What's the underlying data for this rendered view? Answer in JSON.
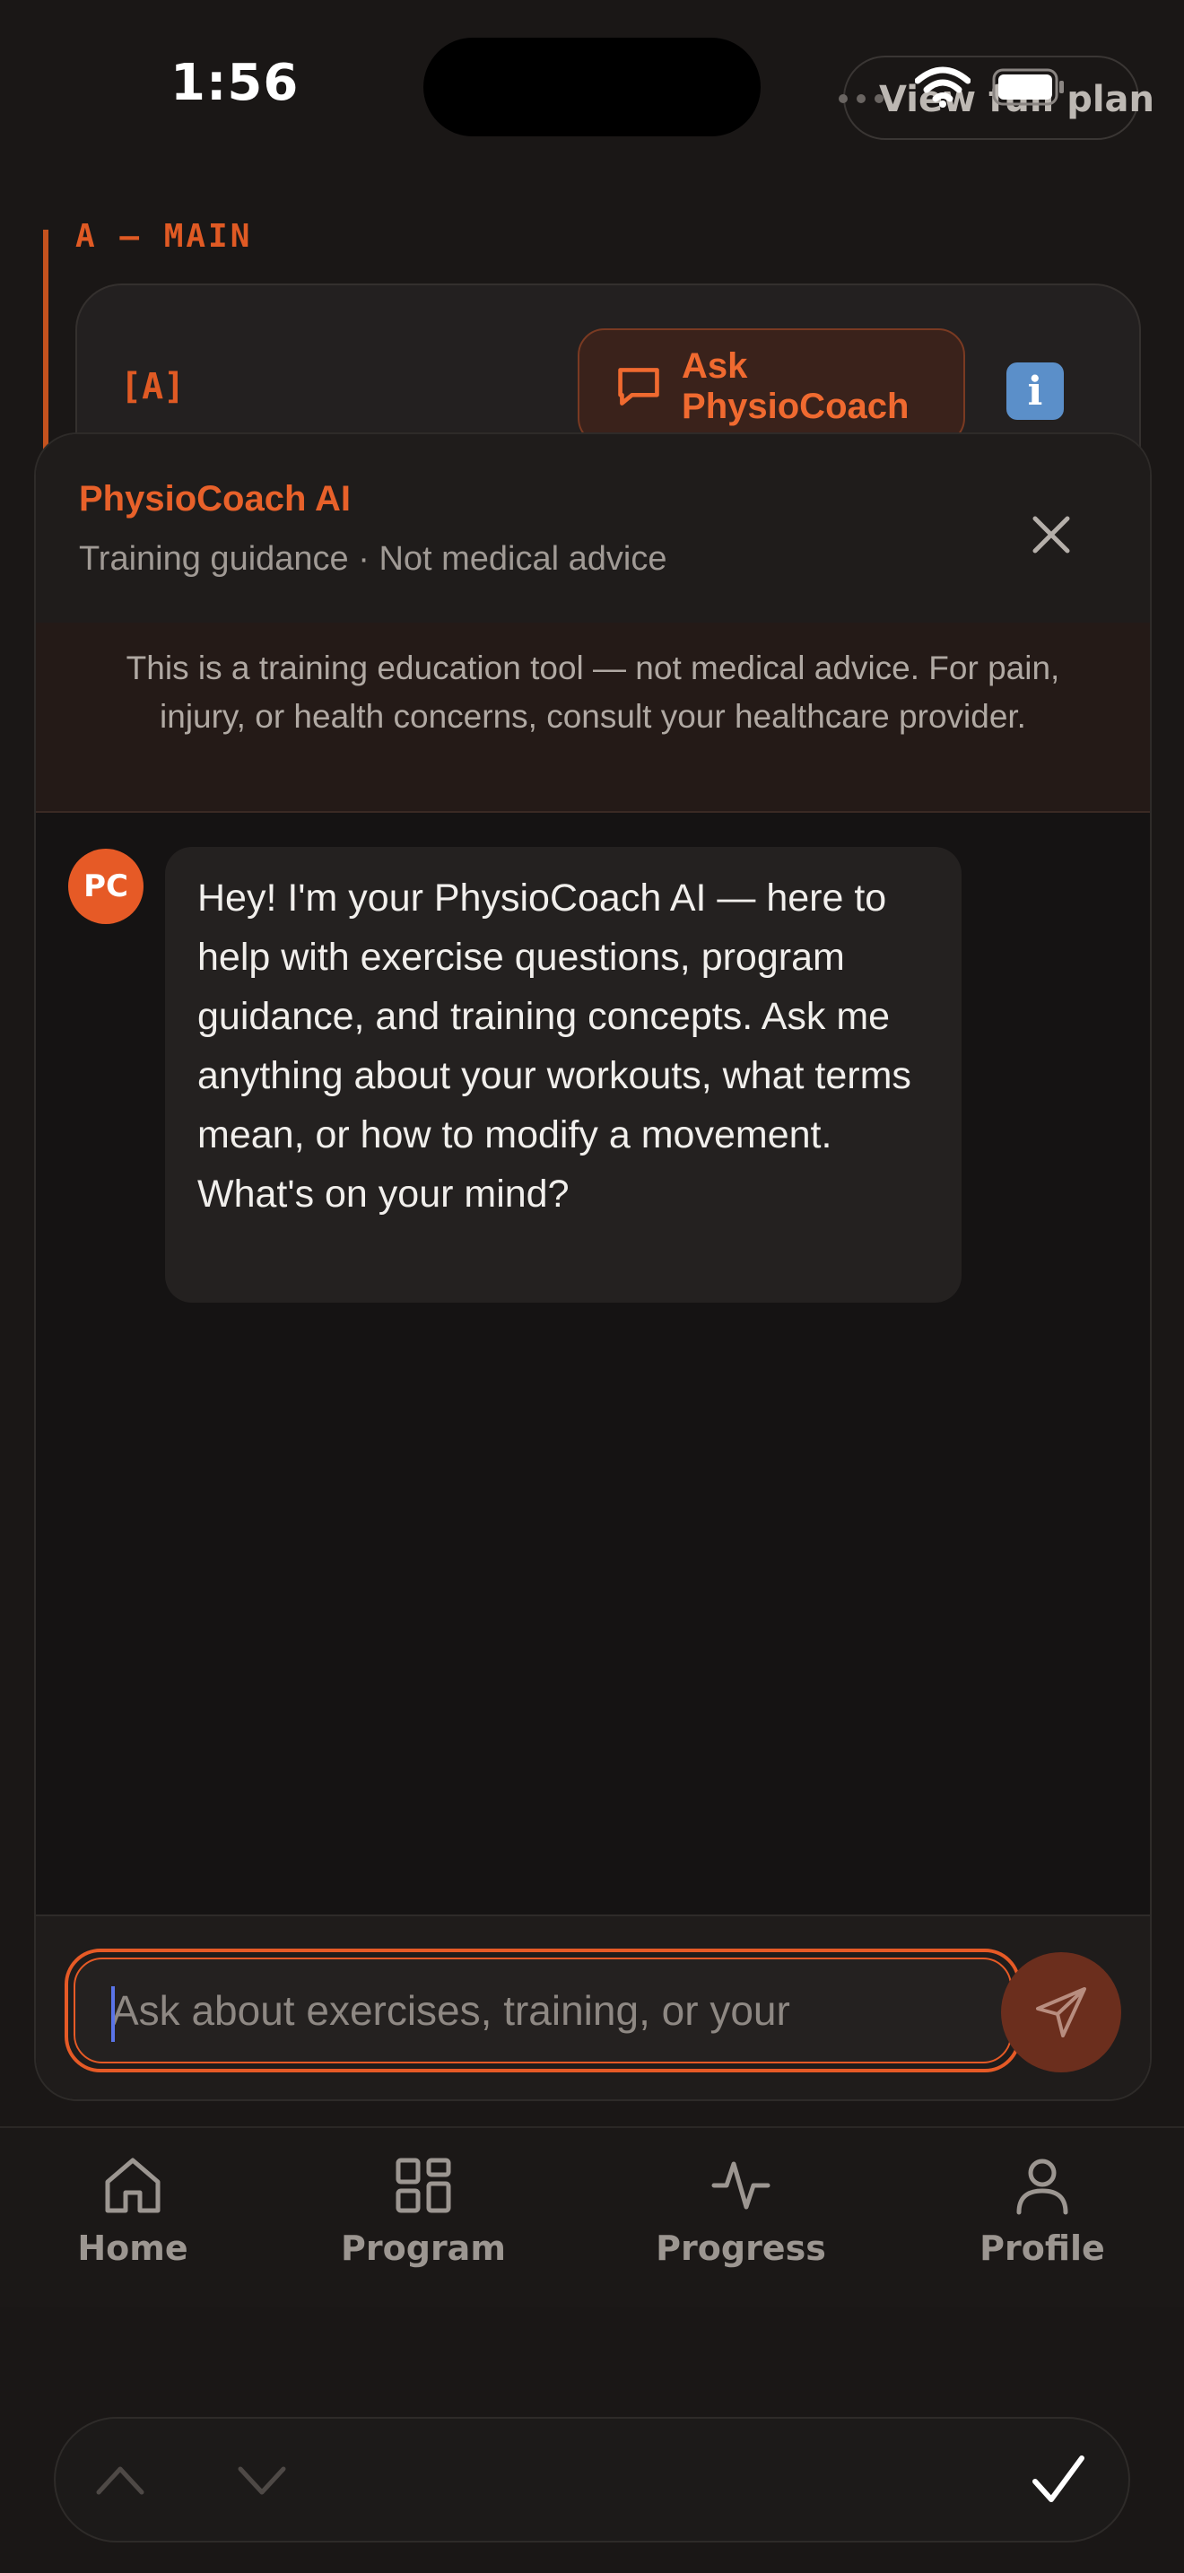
{
  "status_bar": {
    "time": "1:56",
    "view_plan": "View full plan"
  },
  "background": {
    "section_label": "A — MAIN",
    "card_tag": "[A]",
    "ask_button": "Ask PhysioCoach",
    "info_icon": "i"
  },
  "sheet": {
    "title": "PhysioCoach AI",
    "subtitle": "Training guidance · Not medical advice",
    "disclaimer": "This is a training education tool — not medical advice. For pain, injury, or health concerns, consult your healthcare provider.",
    "message": {
      "avatar": "PC",
      "text": "Hey! I'm your PhysioCoach AI — here to help with exercise questions, program guidance, and training concepts. Ask me anything about your workouts, what terms mean, or how to modify a movement. What's on your mind?"
    },
    "input": {
      "placeholder": "Ask about exercises, training, or your",
      "value": ""
    }
  },
  "tabs": [
    {
      "label": "Home",
      "icon": "home-icon"
    },
    {
      "label": "Program",
      "icon": "grid-icon"
    },
    {
      "label": "Progress",
      "icon": "activity-icon"
    },
    {
      "label": "Profile",
      "icon": "user-icon"
    }
  ],
  "colors": {
    "accent": "#e65a26",
    "background": "#1a1716",
    "sheet": "#151313"
  }
}
